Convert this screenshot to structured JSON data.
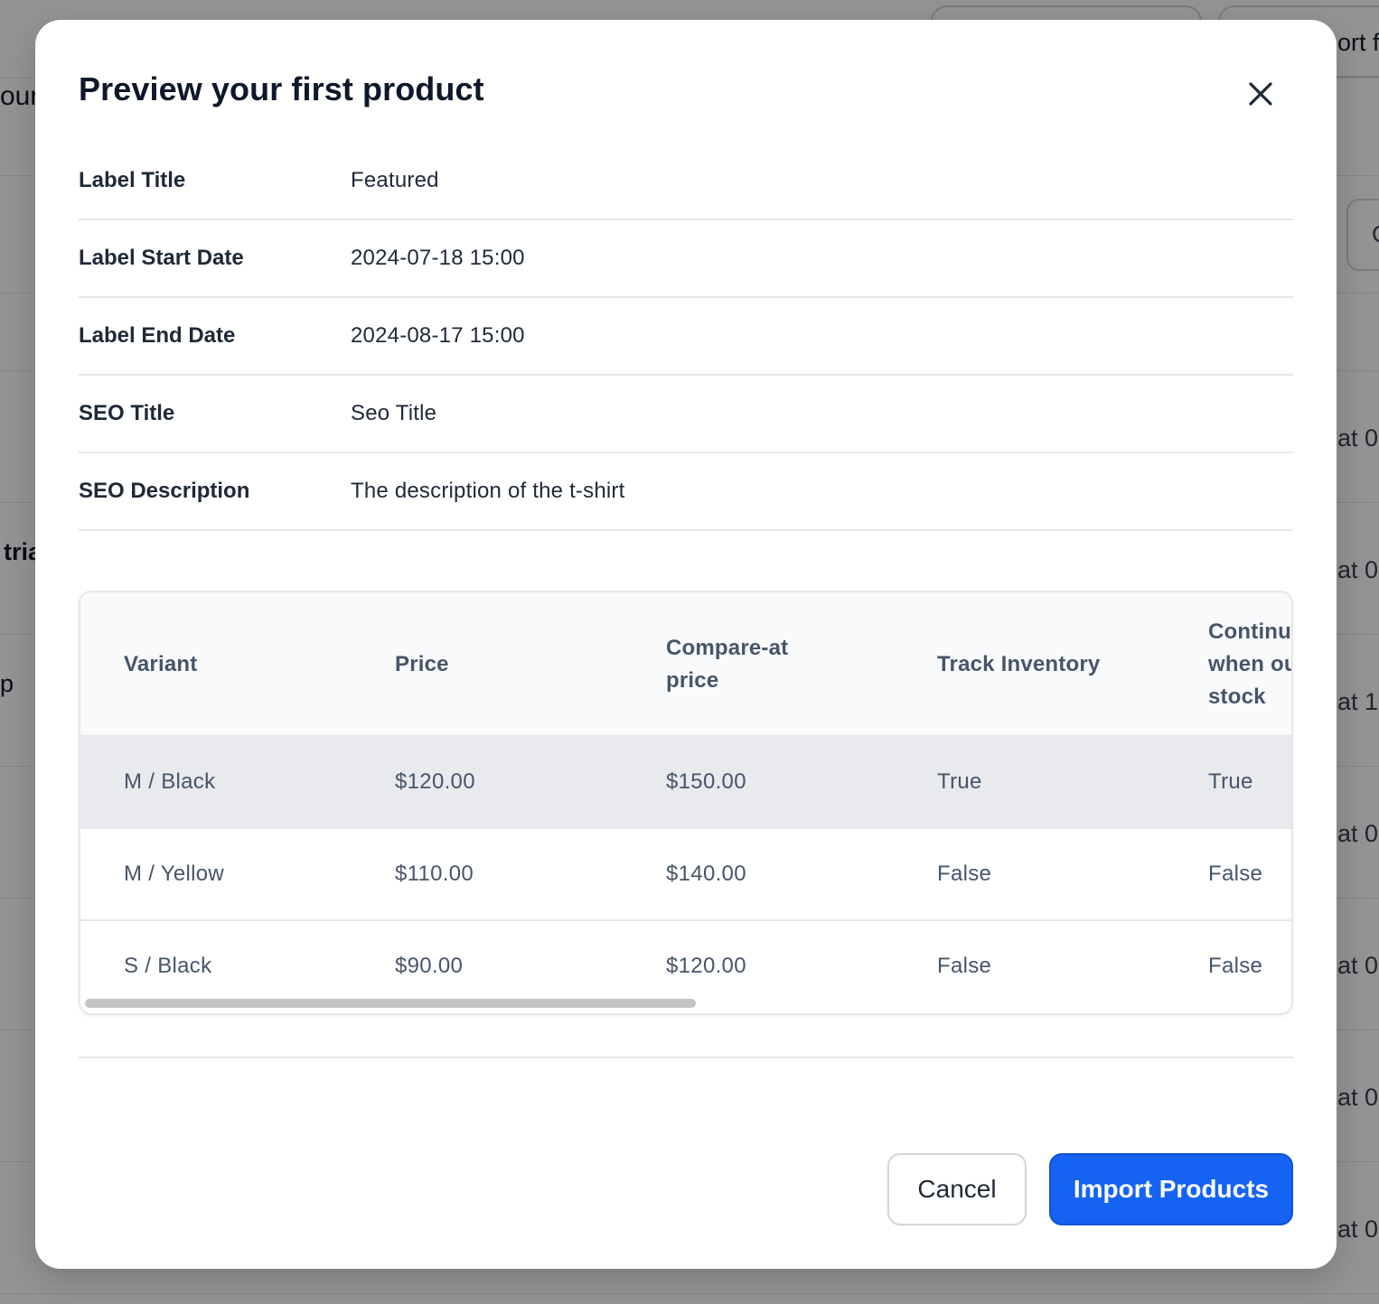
{
  "background": {
    "left_fragments": [
      "our",
      "tria",
      "p"
    ],
    "top_right_fragment": "ort f",
    "chip_fragment": "C",
    "right_fragments": [
      "at 0",
      "at 0",
      "at 1",
      "at 0",
      "at 0",
      "at 0",
      "at 0"
    ]
  },
  "modal": {
    "title": "Preview your first product",
    "close_icon": "close-icon"
  },
  "details": [
    {
      "label": "Label Title",
      "value": "Featured"
    },
    {
      "label": "Label Start Date",
      "value": "2024-07-18 15:00"
    },
    {
      "label": "Label End Date",
      "value": "2024-08-17 15:00"
    },
    {
      "label": "SEO Title",
      "value": "Seo Title"
    },
    {
      "label": "SEO Description",
      "value": "The description of the t-shirt"
    }
  ],
  "table": {
    "headers": [
      "Variant",
      "Price",
      "Compare-at price",
      "Track Inventory",
      "Continue selling when out of stock"
    ],
    "header_lines": {
      "compare": [
        "Compare-at",
        "price"
      ],
      "continue": [
        "Continue",
        "when out",
        "stock"
      ]
    },
    "rows": [
      {
        "variant": "M / Black",
        "price": "$120.00",
        "compare": "$150.00",
        "track": "True",
        "continue": "True"
      },
      {
        "variant": "M / Yellow",
        "price": "$110.00",
        "compare": "$140.00",
        "track": "False",
        "continue": "False"
      },
      {
        "variant": "S / Black",
        "price": "$90.00",
        "compare": "$120.00",
        "track": "False",
        "continue": "False"
      }
    ],
    "horizontal_scroll_fraction": 0.5
  },
  "actions": {
    "cancel": "Cancel",
    "import": "Import Products"
  },
  "colors": {
    "primary": "#1463f3",
    "overlay": "rgba(0,0,0,0.42)",
    "row_highlight": "#e8eaee"
  }
}
